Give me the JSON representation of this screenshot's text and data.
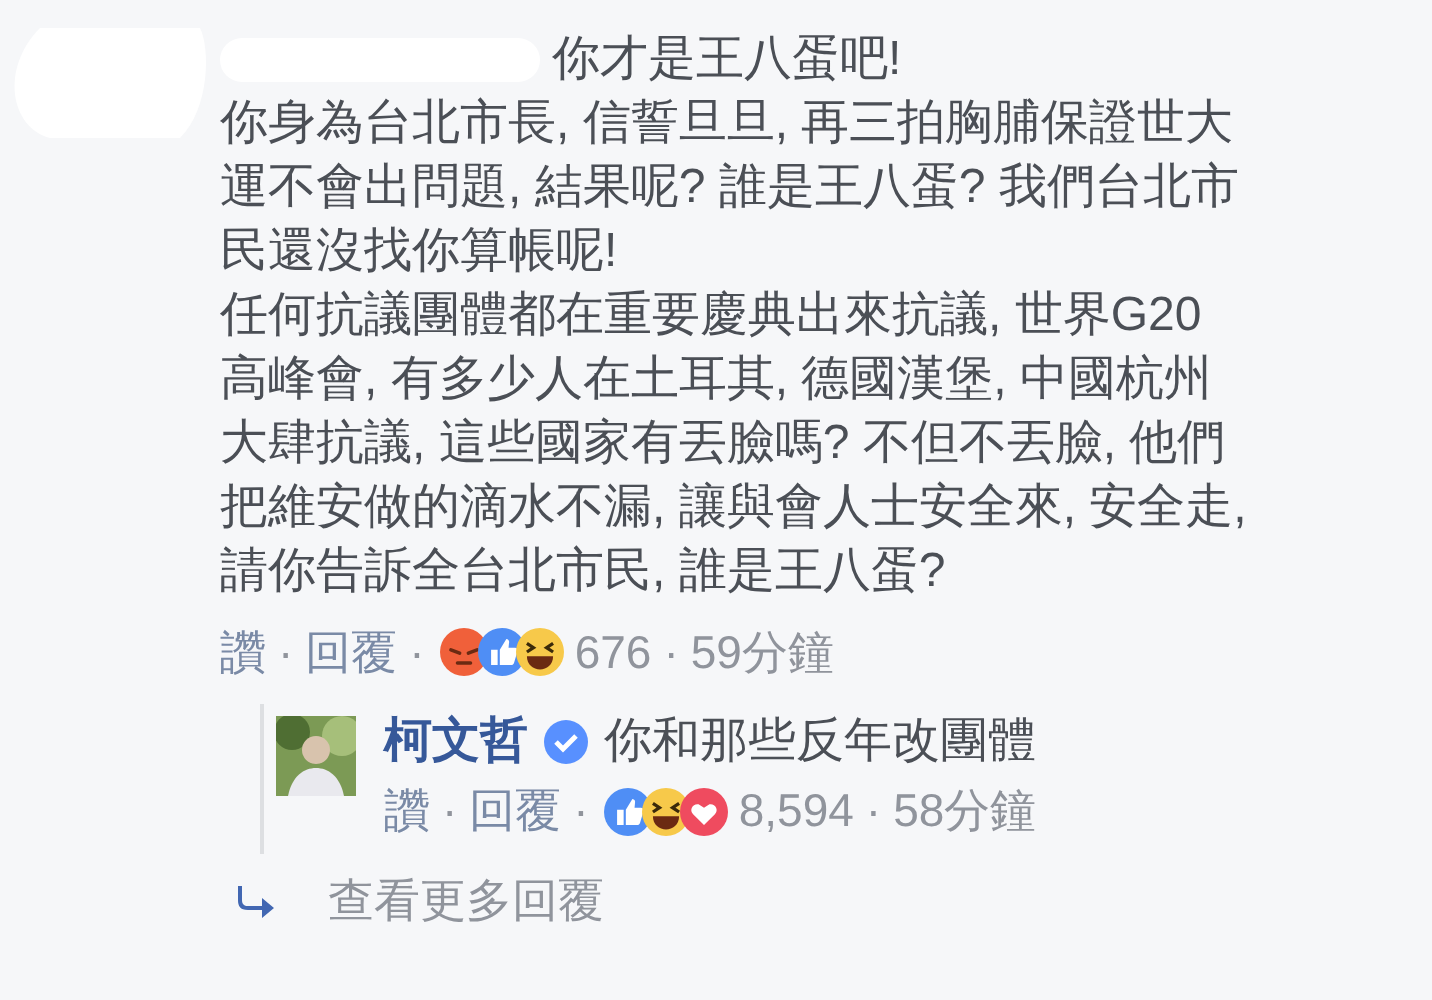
{
  "comment": {
    "text": "你才是王八蛋吧!",
    "paragraphs": [
      "你身為台北市長, 信誓旦旦, 再三拍胸脯保證世大運不會出問題, 結果呢? 誰是王八蛋? 我們台北市民還沒找你算帳呢!",
      "任何抗議團體都在重要慶典出來抗議, 世界G20高峰會, 有多少人在土耳其, 德國漢堡, 中國杭州大肆抗議, 這些國家有丟臉嗎? 不但不丟臉, 他們把維安做的滴水不漏, 讓與會人士安全來, 安全走, 請你告訴全台北市民, 誰是王八蛋?"
    ],
    "meta": [
      {
        "kind": "link",
        "text": "讚"
      },
      {
        "kind": "sep",
        "text": "·"
      },
      {
        "kind": "link",
        "text": "回覆"
      },
      {
        "kind": "sep",
        "text": "·"
      },
      {
        "kind": "reactions",
        "icons": [
          {
            "kind": "angry"
          },
          {
            "kind": "like"
          },
          {
            "kind": "haha"
          }
        ]
      },
      {
        "kind": "count",
        "text": "676"
      },
      {
        "kind": "sep",
        "text": "·"
      },
      {
        "kind": "time",
        "text": "59分鐘"
      }
    ]
  },
  "reply": {
    "author": "柯文哲",
    "verified": true,
    "text": "你和那些反年改團體",
    "meta": [
      {
        "kind": "link",
        "text": "讚"
      },
      {
        "kind": "sep",
        "text": "·"
      },
      {
        "kind": "link",
        "text": "回覆"
      },
      {
        "kind": "sep",
        "text": "·"
      },
      {
        "kind": "reactions",
        "icons": [
          {
            "kind": "like"
          },
          {
            "kind": "haha"
          },
          {
            "kind": "love"
          }
        ]
      },
      {
        "kind": "count",
        "text": "8,594"
      },
      {
        "kind": "sep",
        "text": "·"
      },
      {
        "kind": "time",
        "text": "58分鐘"
      }
    ]
  },
  "more_replies": {
    "label": "查看更多回覆"
  }
}
